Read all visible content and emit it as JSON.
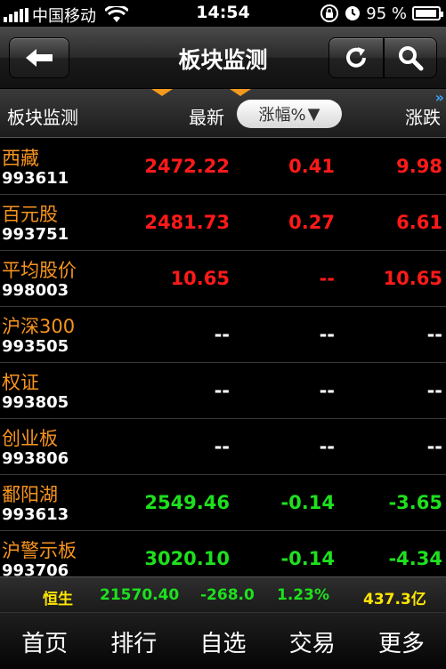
{
  "status": {
    "carrier": "中国移动",
    "time": "14:54",
    "battery": "95 %",
    "battery_level": 0.95
  },
  "header": {
    "title": "板块监测",
    "icons": [
      "back-arrow-icon",
      "refresh-icon",
      "search-icon"
    ]
  },
  "columns": {
    "name": "板块监测",
    "latest": "最新",
    "sort": "涨幅%",
    "sort_indicator": "▼",
    "change": "涨跌",
    "more": "»"
  },
  "rows": [
    {
      "name": "西藏",
      "code": "993611",
      "latest": "2472.22",
      "pct": "0.41",
      "change": "9.98",
      "color": "#ff1a1a"
    },
    {
      "name": "百元股",
      "code": "993751",
      "latest": "2481.73",
      "pct": "0.27",
      "change": "6.61",
      "color": "#ff1a1a"
    },
    {
      "name": "平均股价",
      "code": "998003",
      "latest": "10.65",
      "pct": "--",
      "change": "10.65",
      "color": "#ff1a1a"
    },
    {
      "name": "沪深300",
      "code": "993505",
      "latest": "--",
      "pct": "--",
      "change": "--",
      "color": "#ffffff"
    },
    {
      "name": "权证",
      "code": "993805",
      "latest": "--",
      "pct": "--",
      "change": "--",
      "color": "#ffffff"
    },
    {
      "name": "创业板",
      "code": "993806",
      "latest": "--",
      "pct": "--",
      "change": "--",
      "color": "#ffffff"
    },
    {
      "name": "鄱阳湖",
      "code": "993613",
      "latest": "2549.46",
      "pct": "-0.14",
      "change": "-3.65",
      "color": "#1ee01e"
    },
    {
      "name": "沪警示板",
      "code": "993706",
      "latest": "3020.10",
      "pct": "-0.14",
      "change": "-4.34",
      "color": "#1ee01e"
    }
  ],
  "index": {
    "name": "恒生",
    "value": "21570.40",
    "change": "-268.0",
    "pct": "1.23%",
    "volume": "437.3亿"
  },
  "tabs": [
    "首页",
    "排行",
    "自选",
    "交易",
    "更多"
  ],
  "colors": {
    "accent": "#f7941e",
    "up": "#ff1a1a",
    "down": "#1ee01e",
    "index_value": "#1ee01e",
    "index_volume": "#ffe600"
  }
}
